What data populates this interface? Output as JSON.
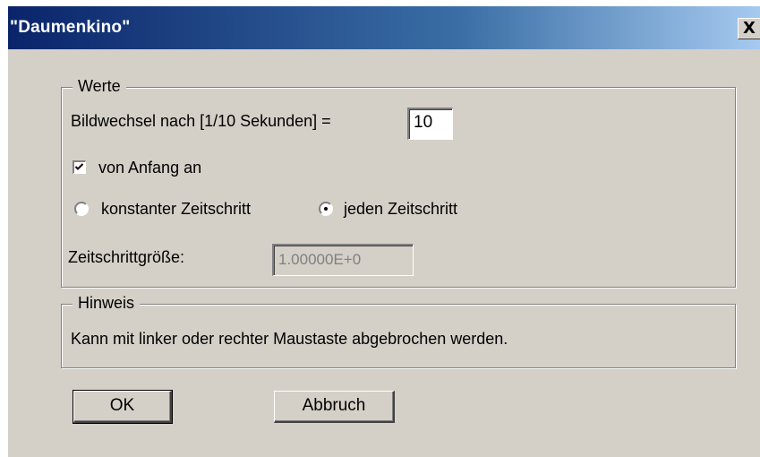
{
  "window": {
    "title": "\"Daumenkino\"",
    "close_glyph": "X"
  },
  "werte": {
    "legend": "Werte",
    "interval_label": "Bildwechsel nach [1/10 Sekunden] =",
    "interval_value": "10",
    "from_start_label": "von Anfang an",
    "from_start_checked": true,
    "radio_constant_label": "konstanter Zeitschritt",
    "radio_each_label": "jeden Zeitschritt",
    "selected_radio": "jeden Zeitschritt",
    "step_size_label": "Zeitschrittgröße:",
    "step_size_value": "1.00000E+0"
  },
  "hinweis": {
    "legend": "Hinweis",
    "text": "Kann mit linker oder rechter Maustaste abgebrochen werden."
  },
  "buttons": {
    "ok": "OK",
    "cancel": "Abbruch"
  },
  "icons": {
    "close": "close-icon",
    "check": "checkmark-icon"
  }
}
